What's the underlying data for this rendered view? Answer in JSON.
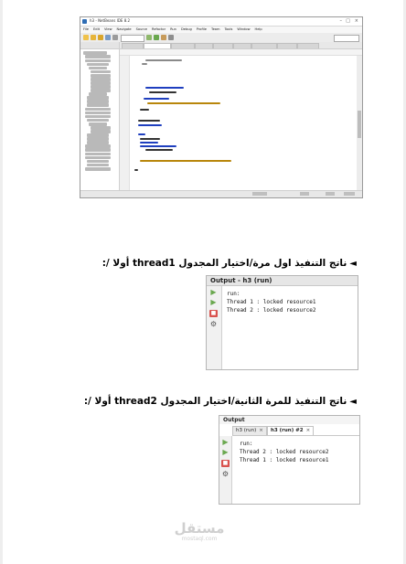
{
  "ide": {
    "window_title": "h3 - NetBeans IDE 8.2",
    "menu": [
      "File",
      "Edit",
      "View",
      "Navigate",
      "Source",
      "Refactor",
      "Run",
      "Debug",
      "Profile",
      "Team",
      "Tools",
      "Window",
      "Help"
    ],
    "config_value": "<default config>",
    "search_placeholder": "Search (Ctrl+I)"
  },
  "captions": {
    "first": "ناتج التنفيذ اول مرة/اختيار المجدول thread1 أولا /:",
    "second": "ناتج التنفيذ للمرة الثانية/اختيار المجدول thread2 أولا /:"
  },
  "output1": {
    "title": "Output - h3 (run)",
    "lines": [
      "run:",
      "Thread 1 : locked resource1",
      "Thread 2 : locked resource2"
    ]
  },
  "output2": {
    "title": "Output",
    "tabs": [
      "h3 (run)",
      "h3 (run) #2"
    ],
    "lines": [
      "run:",
      "Thread 2 : locked resource2",
      "Thread 1 : locked resource1"
    ]
  },
  "watermark": {
    "arabic": "مستقل",
    "latin": "mostaql.com"
  }
}
